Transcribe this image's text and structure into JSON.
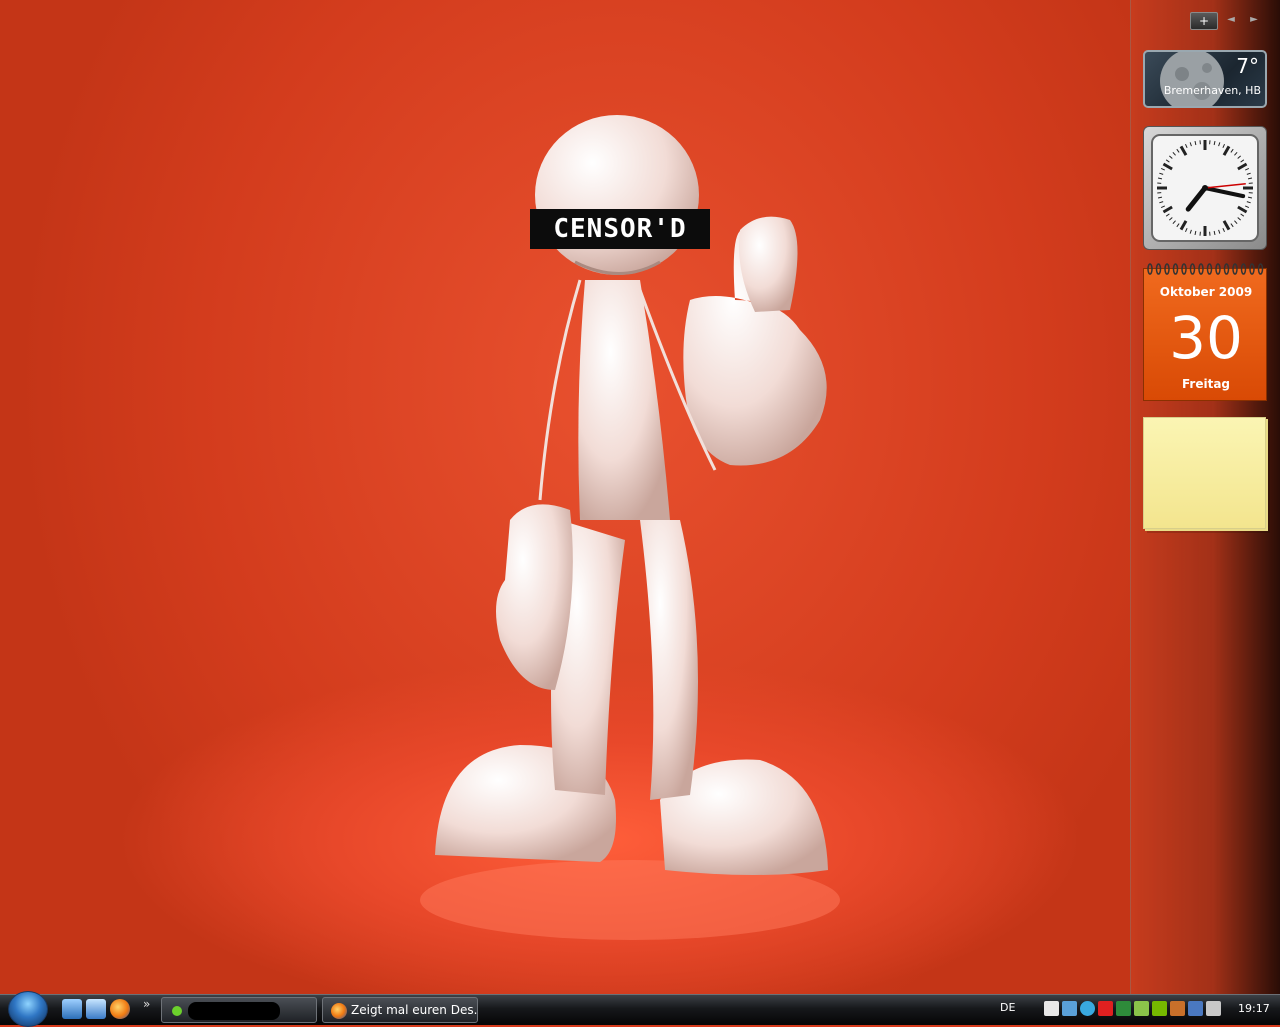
{
  "wallpaper": {
    "censor_text": "CENSOR'D"
  },
  "sidebar": {
    "add_label": "+",
    "prev_label": "◄",
    "next_label": "►"
  },
  "weather": {
    "temperature": "7°",
    "location": "Bremerhaven, HB"
  },
  "clock": {
    "hours": 7,
    "minutes": 17,
    "seconds": 14
  },
  "calendar": {
    "month_year": "Oktober 2009",
    "day": "30",
    "weekday": "Freitag"
  },
  "taskbar": {
    "items": [
      {
        "label": ""
      },
      {
        "label": "Zeigt mal euren Des..."
      }
    ],
    "language": "DE",
    "time": "19:17",
    "chevron": "»"
  },
  "icons": {
    "quicklaunch": [
      "show-desktop-icon",
      "switch-windows-icon",
      "firefox-icon"
    ],
    "tray": [
      "network-icon",
      "monitor-icon",
      "skype-icon",
      "antivir-icon",
      "terminal-icon",
      "vga-icon",
      "nvidia-icon",
      "speaker-app-icon",
      "connection-icon",
      "volume-icon"
    ]
  }
}
